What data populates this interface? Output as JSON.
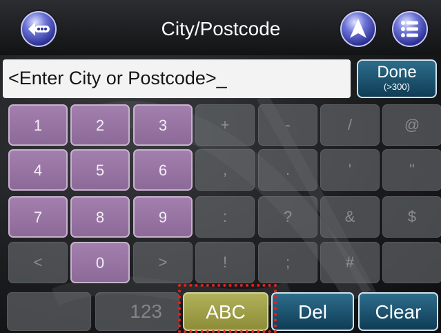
{
  "header": {
    "title": "City/Postcode",
    "back_icon": "back-ellipsis-icon",
    "navigate_icon": "navigation-arrow-icon",
    "menu_icon": "list-menu-icon"
  },
  "entry": {
    "text": "<Enter City or Postcode>_"
  },
  "done": {
    "label": "Done",
    "sublabel": "(>300)"
  },
  "keys": [
    [
      "1",
      "2",
      "3",
      "+",
      "-",
      "/",
      "@"
    ],
    [
      "4",
      "5",
      "6",
      ",",
      ".",
      "'",
      "\""
    ],
    [
      "7",
      "8",
      "9",
      ":",
      "?",
      "&",
      "$"
    ],
    [
      "<",
      "0",
      ">",
      "!",
      ";",
      "#",
      ""
    ]
  ],
  "bottom_row": {
    "key_123": "123",
    "abc": "ABC",
    "del": "Del",
    "clear": "Clear"
  },
  "colors": {
    "digit_key": "#9a78a7",
    "symbol_key": "#696c70",
    "abc_key": "#a5a44f",
    "action_key": "#1f5670",
    "highlight": "#e81f1f"
  }
}
